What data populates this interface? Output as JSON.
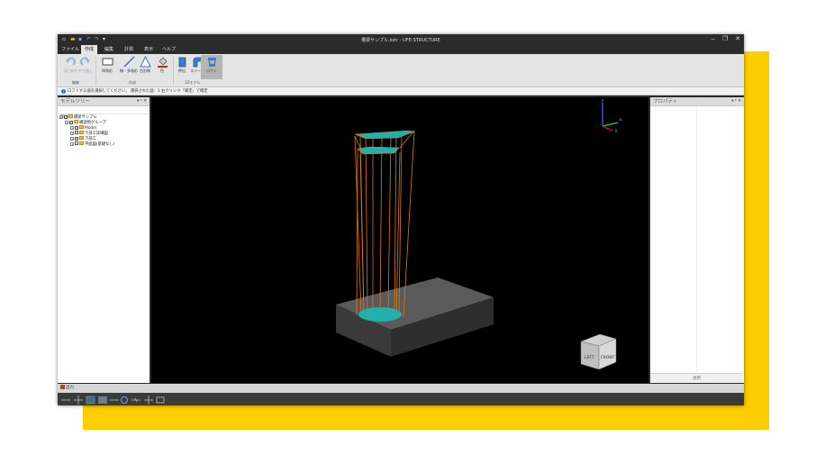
{
  "window": {
    "title": "橋梁サンプル.kstr - UFE-STRUCTURE",
    "controls": [
      "‒",
      "❐",
      "✕"
    ]
  },
  "menu": {
    "tabs": [
      "ファイル",
      "作成",
      "編集",
      "計測",
      "表示",
      "ヘルプ"
    ],
    "active": "作成"
  },
  "ribbon": {
    "buttons": {
      "undo": "元に戻す",
      "redo": "やり直し",
      "rect_shape": "四角形",
      "line_polyline": "線・多角形",
      "trapezoid": "台形線",
      "color": "色",
      "extrude": "押出",
      "sweep": "スイープ",
      "loft": "ロフト"
    },
    "groups": {
      "edit": "編集",
      "create": "作成",
      "model3d": "3Dモデル"
    }
  },
  "hint": {
    "text": "ロフトする面を選択してください。 選択された面：1 右クリック「確定」で確定"
  },
  "model_tree": {
    "title": "モデルツリー",
    "panel_controls": "▾ ᵖ ✕",
    "items": [
      {
        "label": "橋梁サンプル",
        "level": 0
      },
      {
        "label": "構造物グループ",
        "level": 1
      },
      {
        "label": "Model",
        "level": 2
      },
      {
        "label": "下部工詳細図",
        "level": 2
      },
      {
        "label": "下部工",
        "level": 2
      },
      {
        "label": "平面図(基礎なし)",
        "level": 2
      }
    ]
  },
  "properties": {
    "title": "プロパティ",
    "panel_controls": "▾ ᵖ ✕",
    "apply_label": "適用"
  },
  "viewport": {
    "axis_labels": {
      "x": "x",
      "y": "y",
      "z": "z"
    },
    "viewcube": {
      "front": "FRONT",
      "left": "LEFT"
    },
    "colors": {
      "background": "#000000",
      "box": "#3d3d3d",
      "loft_lines": "#e07a10",
      "face": "#20b2aa"
    }
  },
  "output": {
    "label": "出力"
  },
  "colors": {
    "yellow_frame": "#fecd00",
    "chrome_dark": "#2b2b2b",
    "ribbon_bg": "#e4e4e4"
  }
}
